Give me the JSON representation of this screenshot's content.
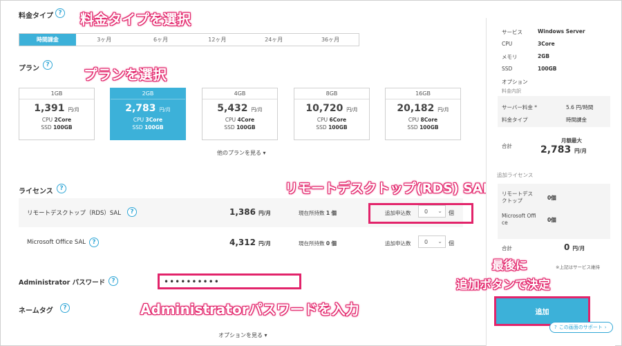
{
  "sections": {
    "price_type": "料金タイプ",
    "plan": "プラン",
    "license": "ライセンス",
    "admin_password": "Administrator パスワード",
    "name_tag": "ネームタグ"
  },
  "period_tabs": [
    "時間課金",
    "3ヶ月",
    "6ヶ月",
    "12ヶ月",
    "24ヶ月",
    "36ヶ月"
  ],
  "plans": [
    {
      "name": "1GB",
      "price": "1,391",
      "unit": "円/月",
      "cpu_label": "CPU",
      "cpu": "2Core",
      "ssd_label": "SSD",
      "ssd": "100GB"
    },
    {
      "name": "2GB",
      "price": "2,783",
      "unit": "円/月",
      "cpu_label": "CPU",
      "cpu": "3Core",
      "ssd_label": "SSD",
      "ssd": "100GB"
    },
    {
      "name": "4GB",
      "price": "5,432",
      "unit": "円/月",
      "cpu_label": "CPU",
      "cpu": "4Core",
      "ssd_label": "SSD",
      "ssd": "100GB"
    },
    {
      "name": "8GB",
      "price": "10,720",
      "unit": "円/月",
      "cpu_label": "CPU",
      "cpu": "6Core",
      "ssd_label": "SSD",
      "ssd": "100GB"
    },
    {
      "name": "16GB",
      "price": "20,182",
      "unit": "円/月",
      "cpu_label": "CPU",
      "cpu": "8Core",
      "ssd_label": "SSD",
      "ssd": "100GB"
    }
  ],
  "other_plans_link": "他のプランを見る",
  "licenses": [
    {
      "name": "リモートデスクトップ（RDS）SAL",
      "price": "1,386",
      "unit": "円/月",
      "owned_label": "現在所持数",
      "owned": "1",
      "owned_unit": "個",
      "add_label": "追加申込数",
      "qty": "0",
      "qty_unit": "個"
    },
    {
      "name": "Microsoft Office SAL",
      "price": "4,312",
      "unit": "円/月",
      "owned_label": "現在所持数",
      "owned": "0",
      "owned_unit": "個",
      "add_label": "追加申込数",
      "qty": "0",
      "qty_unit": "個"
    }
  ],
  "password_value": "••••••••••",
  "options_link": "オプションを見る",
  "annotations": {
    "select_type": "料金タイプを選択",
    "select_plan": "プランを選択",
    "add_rds": "リモートデスクトップ(RDS) SAL追加",
    "enter_password": "Administratorパスワードを入力",
    "finally": "最後に",
    "decide": "追加ボタンで決定"
  },
  "sidebar": {
    "rows": [
      {
        "label": "サービス",
        "value": "Windows Server"
      },
      {
        "label": "CPU",
        "value": "3Core"
      },
      {
        "label": "メモリ",
        "value": "2GB"
      },
      {
        "label": "SSD",
        "value": "100GB"
      },
      {
        "label": "オプション",
        "value": ""
      }
    ],
    "price_details": "料金内訳",
    "server_fee_label": "サーバー料金 *",
    "server_fee_value": "5.6 円/時間",
    "price_type_label": "料金タイプ",
    "price_type_value": "時間課金",
    "monthly_max": "月額最大",
    "total_label": "合計",
    "total_value": "2,783",
    "total_unit": "円/月",
    "lic_header": "追加ライセンス",
    "lic_rds": "リモートデス\nクトップ",
    "lic_rds_count": "0個",
    "lic_office": "Microsoft Offi\nce",
    "lic_office_count": "0個",
    "lic_total_label": "合計",
    "lic_total_value": "0",
    "lic_total_unit": "円/月",
    "note": "※上記はサービス維持",
    "add_button": "追加",
    "support": "この画面のサポート"
  },
  "colors": {
    "accent": "#3cb1d9",
    "annotation": "#e2236a"
  }
}
